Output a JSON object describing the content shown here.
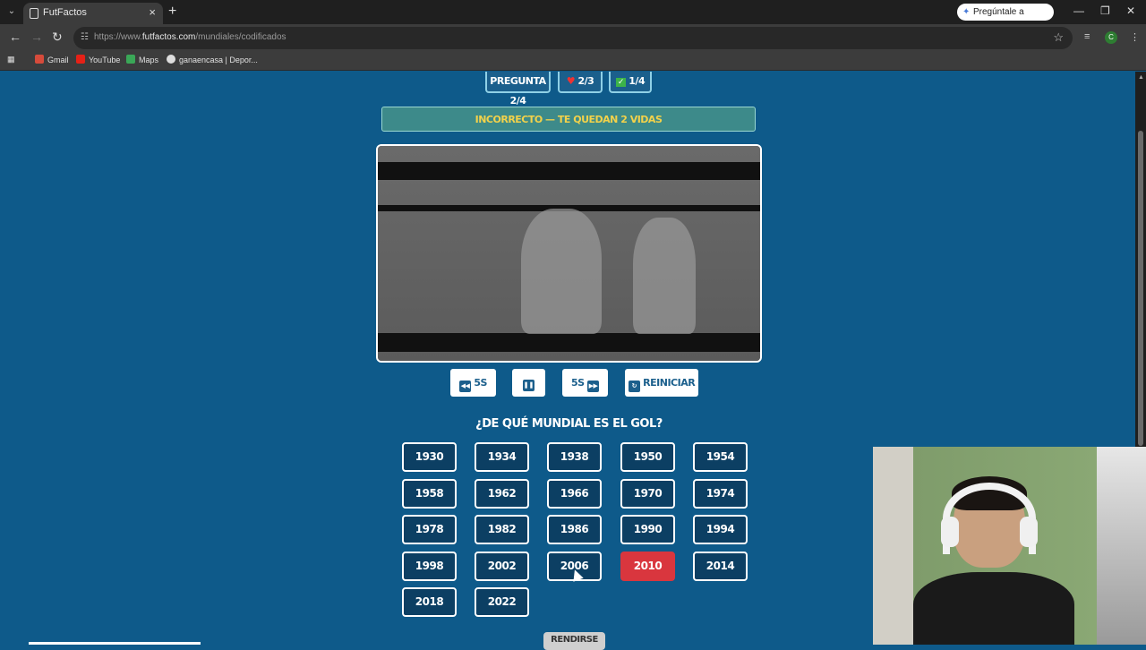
{
  "browser": {
    "tab_title": "FutFactos",
    "url_prefix": "https://www.",
    "url_domain": "futfactos.com",
    "url_path": "/mundiales/codificados",
    "gemini_label": "Pregúntale a Gemini",
    "profile_initial": "C",
    "bookmarks": [
      "Gmail",
      "YouTube",
      "Maps",
      "ganaencasa | Depor..."
    ]
  },
  "game": {
    "question_counter": "PREGUNTA 2/4",
    "lives": "2/3",
    "correct": "1/4",
    "feedback": "INCORRECTO — TE QUEDAN 2 VIDAS",
    "controls": {
      "rewind": "5S",
      "forward": "5S",
      "restart": "REINICIAR"
    },
    "question": "¿DE QUÉ MUNDIAL ES EL GOL?",
    "years": [
      "1930",
      "1934",
      "1938",
      "1950",
      "1954",
      "1958",
      "1962",
      "1966",
      "1970",
      "1974",
      "1978",
      "1982",
      "1986",
      "1990",
      "1994",
      "1998",
      "2002",
      "2006",
      "2010",
      "2014",
      "2018",
      "2022"
    ],
    "wrong_answer": "2010",
    "bottom_button": "RENDIRSE"
  },
  "colors": {
    "page_bg": "#0e5a8a",
    "button_bg": "#0c3f63",
    "wrong_bg": "#d9363e",
    "banner_bg": "#3d8a8a",
    "banner_text": "#f3d24a"
  }
}
